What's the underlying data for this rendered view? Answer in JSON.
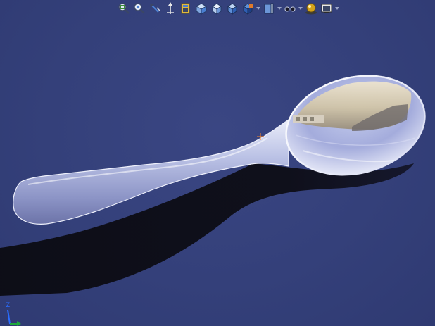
{
  "viewport": {
    "background_color": "#34407a",
    "model": "spoon"
  },
  "toolbar": {
    "items": [
      {
        "name": "zoom-to-fit-icon",
        "has_menu": false
      },
      {
        "name": "zoom-to-area-icon",
        "has_menu": false
      },
      {
        "name": "previous-view-icon",
        "has_menu": false
      },
      {
        "name": "section-view-icon",
        "has_menu": false
      },
      {
        "name": "dynamic-annotation-icon",
        "has_menu": false
      },
      {
        "name": "view-orientation-icon",
        "has_menu": false
      },
      {
        "name": "display-style-icon",
        "has_menu": false
      },
      {
        "name": "shaded-icon",
        "has_menu": false
      },
      {
        "name": "hide-show-items-icon",
        "has_menu": true
      },
      {
        "name": "edit-appearance-icon",
        "has_menu": true
      },
      {
        "name": "appearance-icon",
        "has_menu": true
      },
      {
        "name": "apply-scene-icon",
        "has_menu": false
      },
      {
        "name": "view-settings-icon",
        "has_menu": true
      }
    ]
  },
  "triad": {
    "z_label": "Z",
    "z_color": "#2a6cff",
    "y_color": "#1ea83c"
  },
  "origin_marker": {
    "color": "#ff8a2a"
  }
}
